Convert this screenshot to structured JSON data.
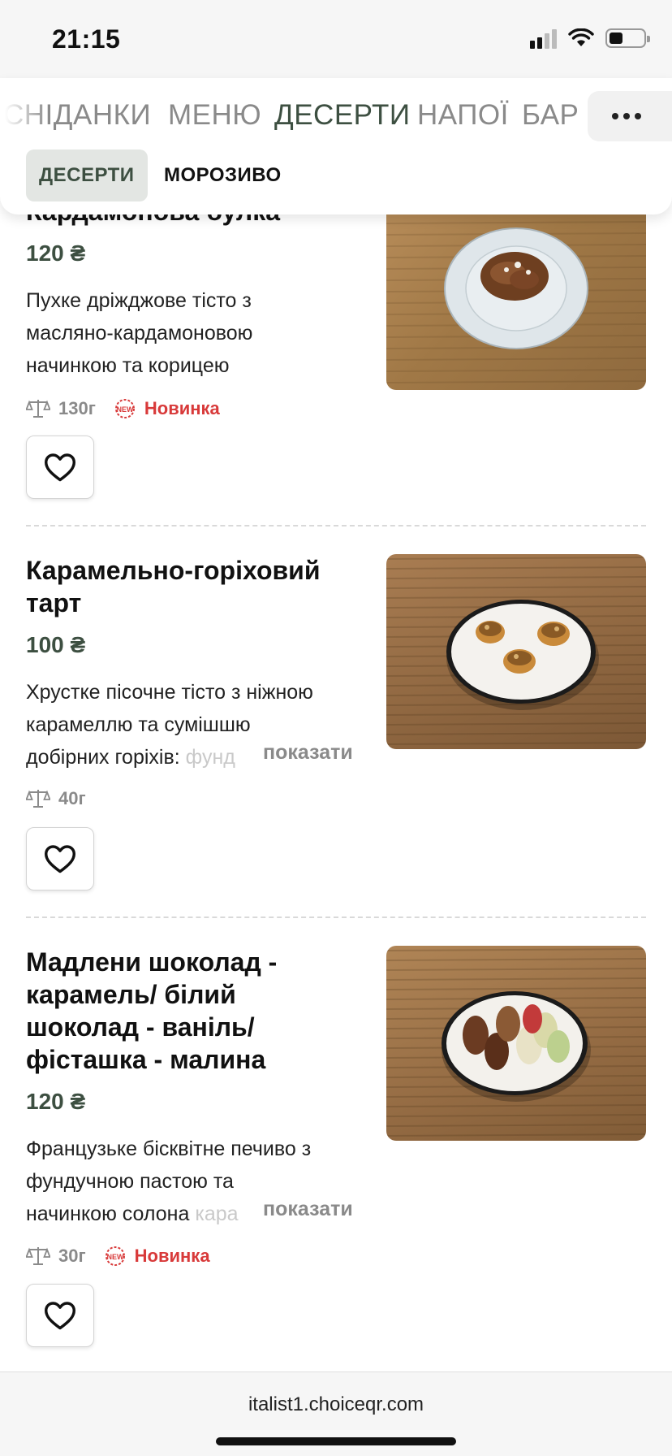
{
  "status_bar": {
    "time": "21:15"
  },
  "header": {
    "categories": [
      {
        "label": "СНІДАНКИ",
        "active": false
      },
      {
        "label": "МЕНЮ",
        "active": false
      },
      {
        "label": "ДЕСЕРТИ",
        "active": true
      },
      {
        "label": "НАПОЇ",
        "active": false
      },
      {
        "label": "БАР",
        "active": false
      }
    ],
    "more_icon": "ellipsis-icon",
    "subcategories": [
      {
        "label": "ДЕСЕРТИ",
        "active": true
      },
      {
        "label": "МОРОЗИВО",
        "active": false
      }
    ]
  },
  "items": [
    {
      "title": "Кардамонова булка",
      "price": "120 ₴",
      "description_lines": [
        "Пухке дріжджове тісто з",
        "масляно-кардамоновою",
        "начинкою та корицею"
      ],
      "weight": "130г",
      "badge": "Новинка",
      "badge_icon": "new-badge-icon",
      "weight_icon": "scale-icon",
      "favorite_icon": "heart-icon"
    },
    {
      "title_lines": [
        "Карамельно-горіховий",
        "тарт"
      ],
      "price": "100 ₴",
      "description_lines": [
        "Хрустке пісочне тісто з ніжною",
        "карамеллю та сумішшю",
        "добірних горіхів: "
      ],
      "description_fade": "фунд",
      "show_more": "показати",
      "weight": "40г",
      "weight_icon": "scale-icon",
      "favorite_icon": "heart-icon"
    },
    {
      "title_lines": [
        "Мадлени шоколад -",
        "карамель/ білий",
        "шоколад - ваніль/",
        "фісташка - малина"
      ],
      "price": "120 ₴",
      "description_lines": [
        "Французьке бісквітне печиво з",
        "фундучною пастою та",
        "начинкою солона "
      ],
      "description_fade": "кара",
      "show_more": "показати",
      "weight": "30г",
      "badge": "Новинка",
      "badge_icon": "new-badge-icon",
      "weight_icon": "scale-icon",
      "favorite_icon": "heart-icon"
    }
  ],
  "browser": {
    "url": "italist1.choiceqr.com"
  },
  "colors": {
    "accent": "#3d4f41",
    "badge": "#d83a3a",
    "muted": "#8a8a8a"
  }
}
